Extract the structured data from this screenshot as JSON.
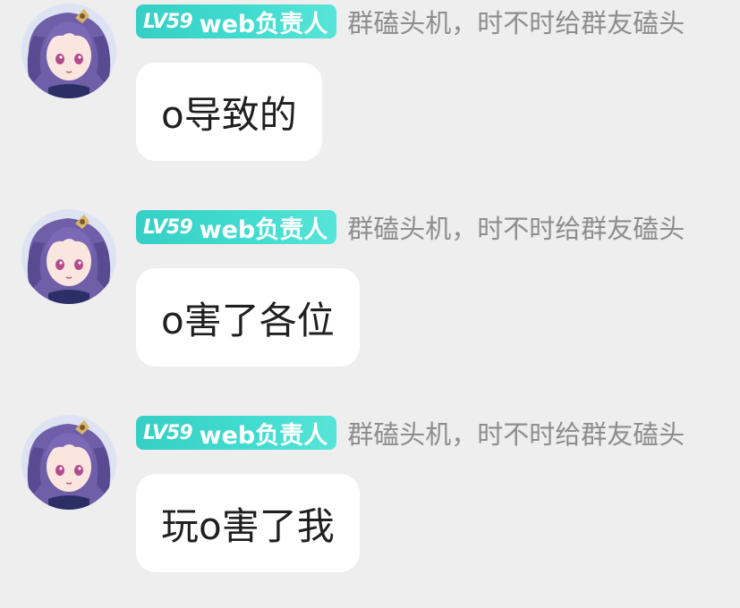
{
  "messages": [
    {
      "level": "LV59",
      "title": "web负责人",
      "nickname": "群磕头机，时不时给群友磕头",
      "text": "o导致的"
    },
    {
      "level": "LV59",
      "title": "web负责人",
      "nickname": "群磕头机，时不时给群友磕头",
      "text": "o害了各位"
    },
    {
      "level": "LV59",
      "title": "web负责人",
      "nickname": "群磕头机，时不时给群友磕头",
      "text": "玩o害了我"
    }
  ],
  "colors": {
    "background": "#eeeeee",
    "badge": "#43dcd0",
    "nickname": "#8d8d8d",
    "bubble": "#ffffff",
    "message_text": "#1f1f1f"
  },
  "icons": {
    "avatar": "anime-girl-purple-hair-avatar"
  }
}
